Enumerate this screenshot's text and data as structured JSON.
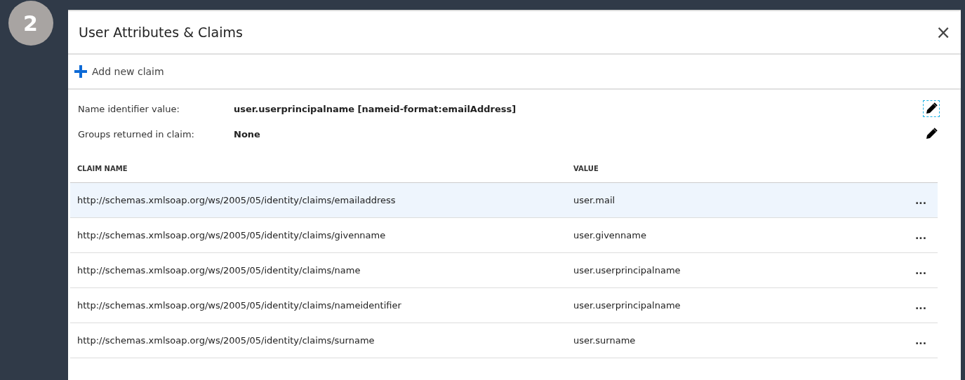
{
  "step_badge": "2",
  "panel": {
    "title": "User Attributes & Claims",
    "close": "×"
  },
  "toolbar": {
    "add_label": "Add new claim"
  },
  "info": [
    {
      "label": "Name identifier value:",
      "value": "user.userprincipalname [nameid-format:emailAddress]",
      "focused": true
    },
    {
      "label": "Groups returned in claim:",
      "value": "None",
      "focused": false
    }
  ],
  "table": {
    "columns": [
      "CLAIM NAME",
      "VALUE"
    ],
    "rows": [
      {
        "claim": "http://schemas.xmlsoap.org/ws/2005/05/identity/claims/emailaddress",
        "value": "user.mail",
        "more": "...",
        "selected": true
      },
      {
        "claim": "http://schemas.xmlsoap.org/ws/2005/05/identity/claims/givenname",
        "value": "user.givenname",
        "more": "...",
        "selected": false
      },
      {
        "claim": "http://schemas.xmlsoap.org/ws/2005/05/identity/claims/name",
        "value": "user.userprincipalname",
        "more": "...",
        "selected": false
      },
      {
        "claim": "http://schemas.xmlsoap.org/ws/2005/05/identity/claims/nameidentifier",
        "value": "user.userprincipalname",
        "more": "...",
        "selected": false
      },
      {
        "claim": "http://schemas.xmlsoap.org/ws/2005/05/identity/claims/surname",
        "value": "user.surname",
        "more": "...",
        "selected": false
      }
    ]
  }
}
